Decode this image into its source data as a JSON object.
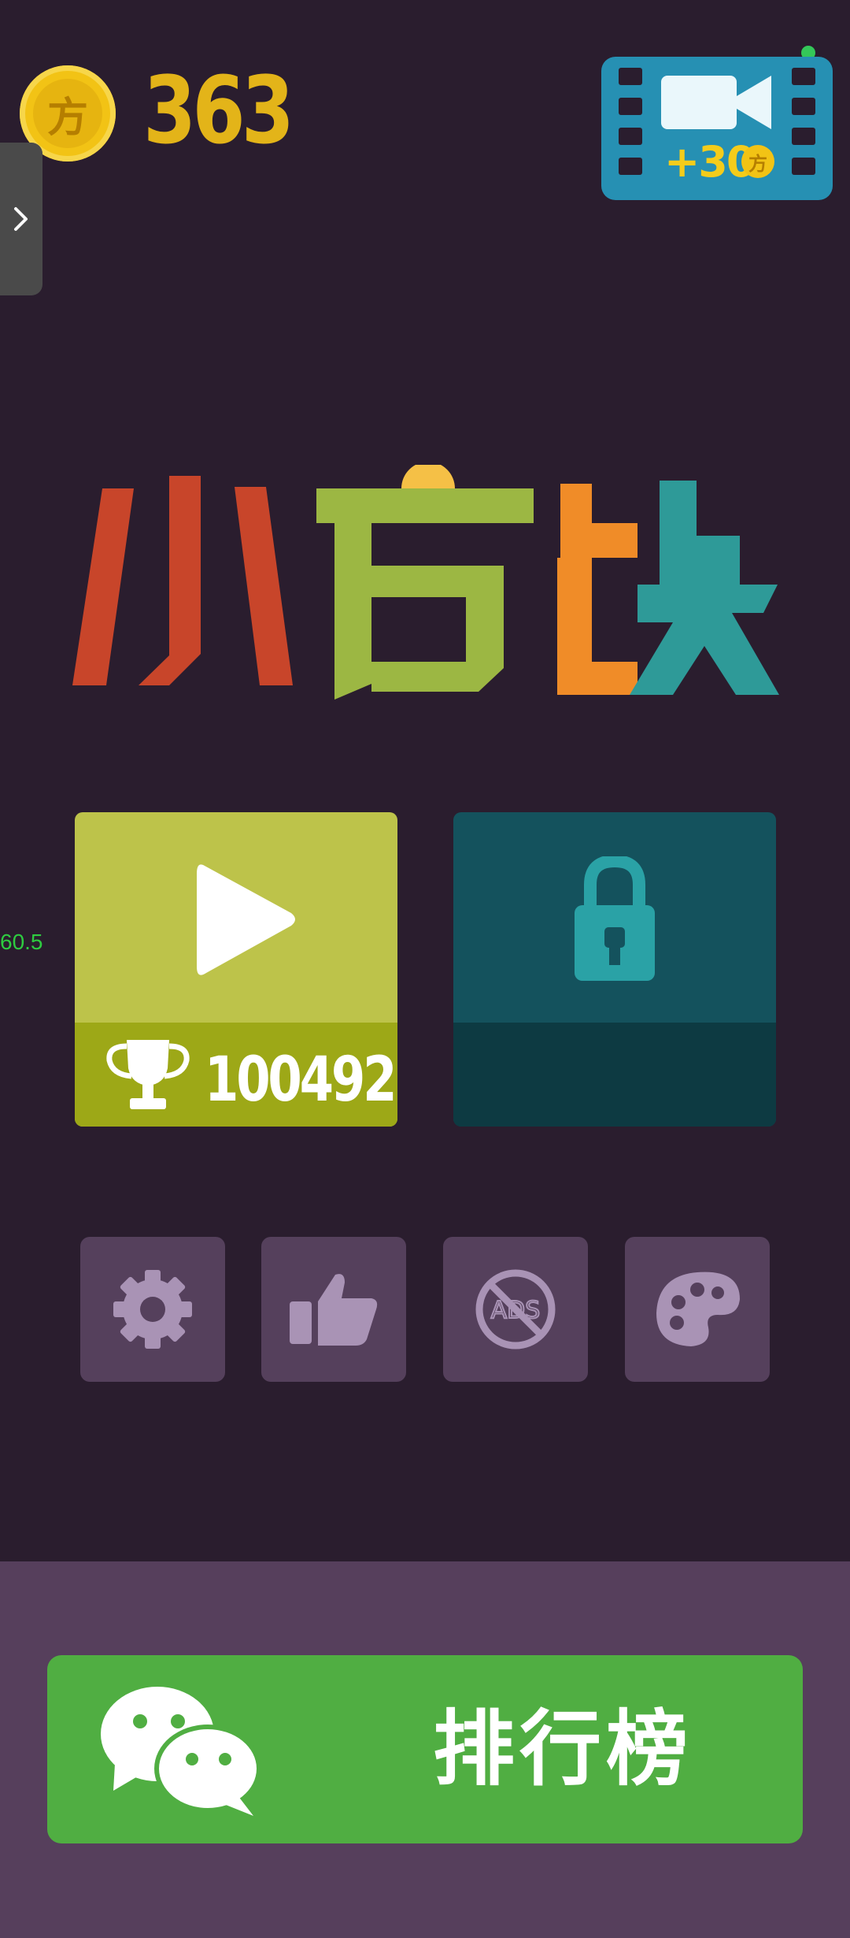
{
  "header": {
    "coin_icon": "fang-coin-icon",
    "coin_glyph": "方",
    "coin_count": "363"
  },
  "side_tab": {
    "icon": "chevron-right-icon"
  },
  "video_reward": {
    "icon": "video-camera-icon",
    "reward_text": "+30",
    "coin_glyph": "方"
  },
  "title": {
    "chars": [
      "小",
      "方",
      "块"
    ],
    "colors": [
      "#c8452a",
      "#9cb743",
      "#f08c28",
      "#2e9a98"
    ]
  },
  "play_card": {
    "icon": "play-icon",
    "trophy_icon": "trophy-icon",
    "best_score": "100492"
  },
  "locked_card": {
    "icon": "lock-icon"
  },
  "debug": {
    "fps": "60.5"
  },
  "menu_icons": [
    {
      "name": "settings",
      "icon": "gear-icon"
    },
    {
      "name": "like",
      "icon": "thumbs-up-icon"
    },
    {
      "name": "no-ads",
      "icon": "no-ads-icon",
      "text": "ADS"
    },
    {
      "name": "theme",
      "icon": "palette-icon"
    }
  ],
  "leaderboard": {
    "icon": "wechat-icon",
    "label": "排行榜"
  },
  "colors": {
    "background": "#2a1d2e",
    "coin": "#f2c315",
    "play_card": "#bdc34a",
    "play_card_bottom": "#9da817",
    "lock_card": "#14525d",
    "lock_card_bottom": "#0d3a42",
    "icon_button": "#55405c",
    "icon_glyph": "#a993b5",
    "footer": "#563f5c",
    "leaderboard_button": "#50ae42"
  }
}
